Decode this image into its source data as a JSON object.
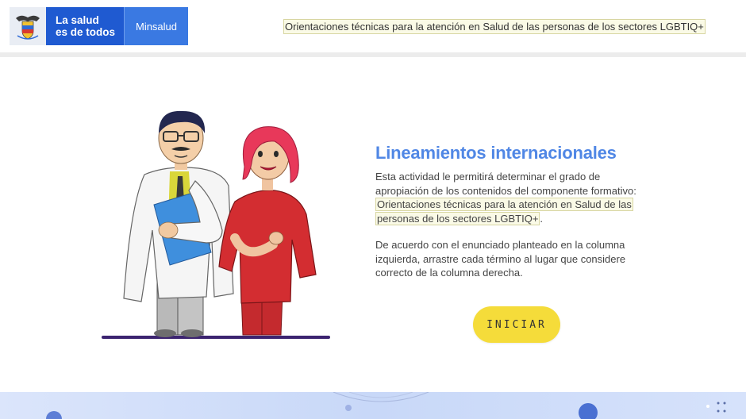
{
  "header": {
    "logo": {
      "line1": "La salud",
      "line2": "es de todos",
      "side": "Minsalud",
      "seal_icon": "colombia-coat-of-arms-icon"
    },
    "title": "Orientaciones técnicas para la atención en Salud de las personas de los sectores LGBTIQ+"
  },
  "main": {
    "heading": "Lineamientos internacionales",
    "intro": "Esta actividad le permitirá determinar el grado de apropiación de los contenidos del componente formativo:",
    "highlight": "Orientaciones técnicas para la atención en Salud de las personas de los sectores LGBTIQ+",
    "period": ".",
    "instructions": "De acuerdo con el enunciado planteado en la columna izquierda, arrastre cada término al lugar que considere correcto de la columna derecha.",
    "start_button": "INICIAR"
  },
  "colors": {
    "brand_blue": "#1f5ad1",
    "heading_blue": "#5087e5",
    "button_yellow": "#f5dc3a",
    "highlight_bg": "#fafae6",
    "ground_line": "#3c2470"
  }
}
